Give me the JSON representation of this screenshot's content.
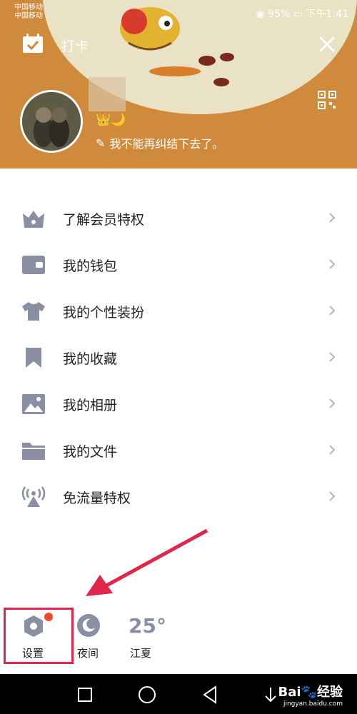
{
  "status_bar": {
    "carrier_1": "中国移动",
    "carrier_2": "中国移动",
    "battery": "95%",
    "time": "下午1:41"
  },
  "header": {
    "checkin_label": "打卡",
    "signature": "我不能再纠结下去了。",
    "badges": "👑🌙"
  },
  "menu": {
    "items": [
      {
        "label": "了解会员特权",
        "icon": "vip-crown-icon"
      },
      {
        "label": "我的钱包",
        "icon": "wallet-icon"
      },
      {
        "label": "我的个性装扮",
        "icon": "tshirt-icon"
      },
      {
        "label": "我的收藏",
        "icon": "bookmark-icon"
      },
      {
        "label": "我的相册",
        "icon": "image-icon"
      },
      {
        "label": "我的文件",
        "icon": "folder-icon"
      },
      {
        "label": "免流量特权",
        "icon": "signal-tower-icon"
      }
    ]
  },
  "bottom_bar": {
    "settings_label": "设置",
    "night_label": "夜间",
    "temperature": "25°",
    "city": "江夏"
  },
  "watermark": {
    "brand": "Bai🐾经验",
    "url": "jingyan.baidu.com"
  },
  "colors": {
    "header_bg": "#cf8a3c",
    "icon_gray": "#8a8fa3",
    "highlight_red": "#e0274b",
    "badge_dot": "#f04a2c"
  }
}
